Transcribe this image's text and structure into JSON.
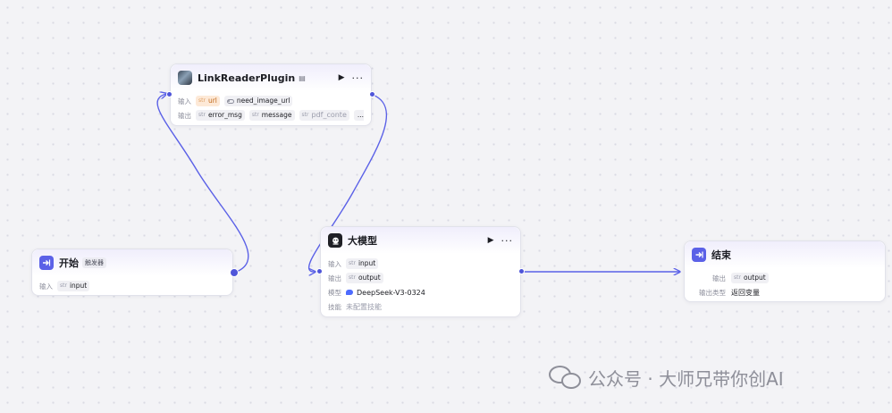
{
  "colors": {
    "accent": "#5b61e7",
    "edge": "#5b61e7",
    "warn_chip": "#fde9d7",
    "watermark": "#8e8f99"
  },
  "nodes": {
    "start": {
      "title": "开始",
      "badge": "触发器",
      "icon": "start-arrow-icon",
      "rows": [
        {
          "label": "输入",
          "vars": [
            {
              "type": "str",
              "name": "input"
            }
          ]
        }
      ]
    },
    "plugin": {
      "title": "LinkReaderPlugin",
      "icon": "plugin-image-icon",
      "inputs_label": "输入",
      "inputs": [
        {
          "type": "str",
          "name": "url",
          "warn": true
        },
        {
          "type": "toggle",
          "name": "need_image_url"
        }
      ],
      "outputs_label": "输出",
      "outputs": [
        {
          "type": "str",
          "name": "error_msg"
        },
        {
          "type": "str",
          "name": "message"
        },
        {
          "type": "str",
          "name": "pdf_conte"
        }
      ],
      "outputs_more": "..."
    },
    "llm": {
      "title": "大模型",
      "icon": "llm-icon",
      "inputs_label": "输入",
      "input": {
        "type": "str",
        "name": "input"
      },
      "outputs_label": "输出",
      "output": {
        "type": "str",
        "name": "output"
      },
      "model_label": "模型",
      "model": "DeepSeek-V3-0324",
      "skills_label": "技能",
      "skills": "未配置技能"
    },
    "end": {
      "title": "结束",
      "icon": "end-arrow-icon",
      "outputs_label": "输出",
      "output": {
        "type": "str",
        "name": "output"
      },
      "output_type_label": "输出类型",
      "output_type": "返回变量"
    }
  },
  "watermark": {
    "text": "公众号 · 大师兄带你创AI",
    "icon": "wechat-icon"
  }
}
